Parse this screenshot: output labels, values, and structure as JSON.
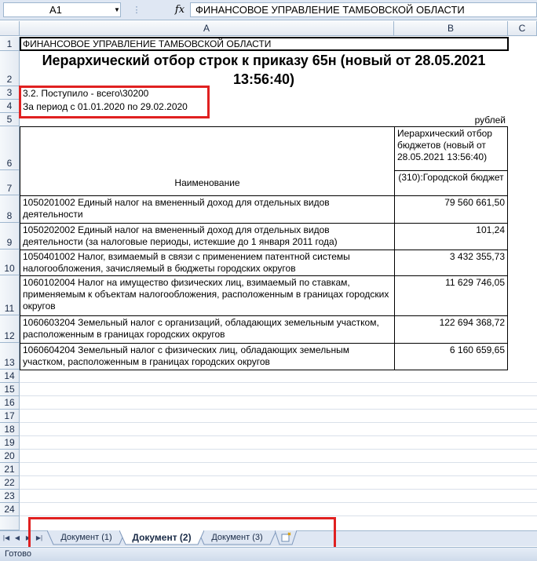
{
  "formula_bar": {
    "name_box": "A1",
    "fx_label": "fx",
    "formula": "ФИНАНСОВОЕ УПРАВЛЕНИЕ ТАМБОВСКОЙ ОБЛАСТИ"
  },
  "columns": [
    "A",
    "B",
    "C"
  ],
  "rows": [
    "1",
    "2",
    "3",
    "4",
    "5",
    "6",
    "7",
    "8",
    "9",
    "10",
    "11",
    "12",
    "13",
    "14",
    "15",
    "16",
    "17",
    "18",
    "19",
    "20",
    "21",
    "22",
    "23",
    "24"
  ],
  "sheet": {
    "org": "ФИНАНСОВОЕ УПРАВЛЕНИЕ ТАМБОВСКОЙ ОБЛАСТИ",
    "title": "Иерархический отбор строк к приказу 65н (новый от 28.05.2021 13:56:40)",
    "subtitle1": "3.2. Поступило - всего\\30200",
    "subtitle2": "За период с 01.01.2020 по 29.02.2020",
    "units": "рублей",
    "header_name": "Наименование",
    "header_group": "Иерархический отбор бюджетов (новый от 28.05.2021 13:56:40)",
    "header_budget": "(310):Городской бюджет",
    "data_rows": [
      {
        "name": "1050201002 Единый налог на вмененный доход для отдельных видов деятельности",
        "value": "79 560 661,50"
      },
      {
        "name": "1050202002 Единый налог на вмененный доход для отдельных видов деятельности (за налоговые периоды, истекшие до 1 января 2011 года)",
        "value": "101,24"
      },
      {
        "name": "1050401002 Налог, взимаемый в связи с применением патентной системы налогообложения, зачисляемый в бюджеты городских округов",
        "value": "3 432 355,73"
      },
      {
        "name": "1060102004 Налог на имущество физических лиц, взимаемый по ставкам, применяемым к объектам налогообложения, расположенным в границах городских округов",
        "value": "11 629 746,05"
      },
      {
        "name": "1060603204 Земельный налог с организаций, обладающих земельным участком, расположенным в границах городских округов",
        "value": "122 694 368,72"
      },
      {
        "name": "1060604204 Земельный налог с физических лиц, обладающих земельным участком, расположенным в границах городских округов",
        "value": "6 160 659,65"
      }
    ]
  },
  "tabs": [
    {
      "label": "Документ (1)",
      "active": false
    },
    {
      "label": "Документ (2)",
      "active": true
    },
    {
      "label": "Документ (3)",
      "active": false
    }
  ],
  "status": "Готово",
  "highlight_color": "#e02020"
}
